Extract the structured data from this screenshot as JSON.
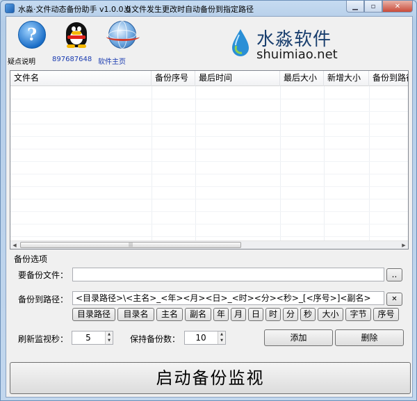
{
  "window": {
    "title": "水淼·文件动态备份助手 v1.0.0.0",
    "subtitle": "当文件发生更改时自动备份到指定路径"
  },
  "header": {
    "help_label": "疑点说明",
    "qq_label": "897687648",
    "home_label": "软件主页",
    "logo_cn": "水淼软件",
    "logo_en": "shuimiao.net"
  },
  "list": {
    "columns": [
      "文件名",
      "备份序号",
      "最后时间",
      "最后大小",
      "新增大小",
      "备份到路径"
    ]
  },
  "options": {
    "group_label": "备份选项",
    "file_label": "要备份文件：",
    "file_value": "",
    "browse_label": "..",
    "path_label": "备份到路径：",
    "path_value": "<目录路径>\\<主名>_<年><月><日>_<时><分><秒>_[<序号>]<副名>",
    "clear_label": "✕",
    "tokens": [
      "目录路径",
      "目录名",
      "主名",
      "副名",
      "年",
      "月",
      "日",
      "时",
      "分",
      "秒",
      "大小",
      "字节",
      "序号"
    ],
    "refresh_label": "刷新监视秒：",
    "refresh_value": "5",
    "keep_label": "保持备份数：",
    "keep_value": "10",
    "add_label": "添加",
    "delete_label": "删除"
  },
  "start_label": "启动备份监视",
  "colors": {
    "accent_close": "#c94a38",
    "logo_blue": "#1a3f6e"
  }
}
